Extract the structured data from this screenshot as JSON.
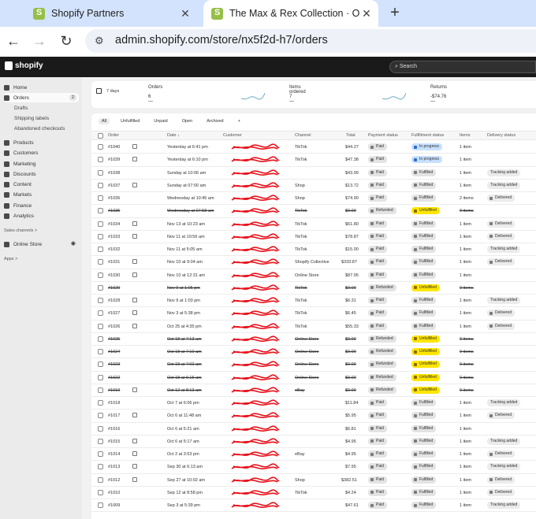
{
  "browser": {
    "tabs": [
      {
        "title": "Shopify Partners"
      },
      {
        "title": "The Max & Rex Collection · Ord"
      }
    ],
    "url": "admin.shopify.com/store/nx5f2d-h7/orders"
  },
  "topbar": {
    "logo": "shopify",
    "search_placeholder": "Search"
  },
  "sidebar": {
    "items": [
      {
        "label": "Home"
      },
      {
        "label": "Orders",
        "badge": "2"
      },
      {
        "label": "Drafts"
      },
      {
        "label": "Shipping labels"
      },
      {
        "label": "Abandoned checkouts"
      },
      {
        "label": "Products"
      },
      {
        "label": "Customers"
      },
      {
        "label": "Marketing"
      },
      {
        "label": "Discounts"
      },
      {
        "label": "Content"
      },
      {
        "label": "Markets"
      },
      {
        "label": "Finance"
      },
      {
        "label": "Analytics"
      }
    ],
    "sales_channels": "Sales channels >",
    "online_store": "Online Store",
    "apps": "Apps >"
  },
  "stats": {
    "range": "7 days",
    "orders_label": "Orders",
    "orders_value": "6 —",
    "items_label": "Items ordered",
    "items_value": "7 —",
    "returns_label": "Returns",
    "returns_value": "-$74.76 —"
  },
  "views": [
    "All",
    "Unfulfilled",
    "Unpaid",
    "Open",
    "Archived",
    "+"
  ],
  "columns": [
    "Order",
    "Date ↓",
    "Customer",
    "Channel",
    "Total",
    "Payment status",
    "Fulfillment status",
    "Items",
    "Delivery status"
  ],
  "orders": [
    {
      "id": "#1040",
      "date": "Yesterday at 6:41 pm",
      "channel": "TikTok",
      "total": "$44.27",
      "payment": "Paid",
      "fulfillment": "In progress",
      "items": "1 item",
      "delivery": "",
      "note": true
    },
    {
      "id": "#1039",
      "date": "Yesterday at 6:10 pm",
      "channel": "TikTok",
      "total": "$47.38",
      "payment": "Paid",
      "fulfillment": "In progress",
      "items": "1 item",
      "delivery": "",
      "note": true
    },
    {
      "id": "#1038",
      "date": "Sunday at 10:06 am",
      "channel": "",
      "total": "$43.99",
      "payment": "Paid",
      "fulfillment": "Fulfilled",
      "items": "1 item",
      "delivery": "Tracking added",
      "note": false
    },
    {
      "id": "#1037",
      "date": "Sunday at 07:00 am",
      "channel": "Shop",
      "total": "$13.72",
      "payment": "Paid",
      "fulfillment": "Fulfilled",
      "items": "1 item",
      "delivery": "Tracking added",
      "note": true
    },
    {
      "id": "#1036",
      "date": "Wednesday at 10:45 am",
      "channel": "Shop",
      "total": "$74.90",
      "payment": "Paid",
      "fulfillment": "Fulfilled",
      "items": "2 items",
      "delivery": "Delivered",
      "note": false
    },
    {
      "id": "#1035",
      "date": "Wednesday at 07:58 am",
      "channel": "TikTok",
      "total": "$0.00",
      "payment": "Refunded",
      "fulfillment": "Unfulfilled",
      "items": "0 items",
      "delivery": "",
      "note": false,
      "void": true
    },
    {
      "id": "#1034",
      "date": "Nov 13 at 10:23 am",
      "channel": "TikTok",
      "total": "$61.80",
      "payment": "Paid",
      "fulfillment": "Fulfilled",
      "items": "1 item",
      "delivery": "Delivered",
      "note": true
    },
    {
      "id": "#1033",
      "date": "Nov 11 at 10:56 am",
      "channel": "TikTok",
      "total": "$78.87",
      "payment": "Paid",
      "fulfillment": "Fulfilled",
      "items": "1 item",
      "delivery": "Delivered",
      "note": true
    },
    {
      "id": "#1032",
      "date": "Nov 11 at 5:05 am",
      "channel": "TikTok",
      "total": "$15.00",
      "payment": "Paid",
      "fulfillment": "Fulfilled",
      "items": "1 item",
      "delivery": "Tracking added",
      "note": false
    },
    {
      "id": "#1031",
      "date": "Nov 10 at 9:04 am",
      "channel": "Shopify Collective",
      "total": "$333.87",
      "payment": "Paid",
      "fulfillment": "Fulfilled",
      "items": "1 item",
      "delivery": "Delivered",
      "note": true
    },
    {
      "id": "#1030",
      "date": "Nov 10 at 12:31 am",
      "channel": "Online Store",
      "total": "$87.95",
      "payment": "Paid",
      "fulfillment": "Fulfilled",
      "items": "1 item",
      "delivery": "",
      "note": true
    },
    {
      "id": "#1029",
      "date": "Nov 9 at 1:05 pm",
      "channel": "TikTok",
      "total": "$0.00",
      "payment": "Refunded",
      "fulfillment": "Unfulfilled",
      "items": "0 items",
      "delivery": "",
      "note": false,
      "void": true
    },
    {
      "id": "#1028",
      "date": "Nov 9 at 1:03 pm",
      "channel": "TikTok",
      "total": "$6.31",
      "payment": "Paid",
      "fulfillment": "Fulfilled",
      "items": "1 item",
      "delivery": "Tracking added",
      "note": true
    },
    {
      "id": "#1027",
      "date": "Nov 3 at 5:38 pm",
      "channel": "TikTok",
      "total": "$6.45",
      "payment": "Paid",
      "fulfillment": "Fulfilled",
      "items": "1 item",
      "delivery": "Delivered",
      "note": true
    },
    {
      "id": "#1026",
      "date": "Oct 25 at 4:35 pm",
      "channel": "TikTok",
      "total": "$55.33",
      "payment": "Paid",
      "fulfillment": "Fulfilled",
      "items": "1 item",
      "delivery": "Delivered",
      "note": true
    },
    {
      "id": "#1025",
      "date": "Oct 18 at 7:13 am",
      "channel": "Online Store",
      "total": "$0.00",
      "payment": "Refunded",
      "fulfillment": "Unfulfilled",
      "items": "0 items",
      "delivery": "",
      "note": false,
      "void": true
    },
    {
      "id": "#1024",
      "date": "Oct 18 at 7:10 am",
      "channel": "Online Store",
      "total": "$0.00",
      "payment": "Refunded",
      "fulfillment": "Unfulfilled",
      "items": "0 items",
      "delivery": "",
      "note": false,
      "void": true
    },
    {
      "id": "#1023",
      "date": "Oct 18 at 7:02 am",
      "channel": "Online Store",
      "total": "$0.00",
      "payment": "Refunded",
      "fulfillment": "Unfulfilled",
      "items": "0 items",
      "delivery": "",
      "note": false,
      "void": true
    },
    {
      "id": "#1022",
      "date": "Oct 18 at 6:15 am",
      "channel": "Online Store",
      "total": "$0.00",
      "payment": "Refunded",
      "fulfillment": "Unfulfilled",
      "items": "0 items",
      "delivery": "",
      "note": false,
      "void": true
    },
    {
      "id": "#1019",
      "date": "Oct 12 at 8:13 am",
      "channel": "eBay",
      "total": "$0.00",
      "payment": "Refunded",
      "fulfillment": "Unfulfilled",
      "items": "0 items",
      "delivery": "",
      "note": true,
      "void": true
    },
    {
      "id": "#1018",
      "date": "Oct 7 at 6:06 pm",
      "channel": "",
      "total": "$11.84",
      "payment": "Paid",
      "fulfillment": "Fulfilled",
      "items": "1 item",
      "delivery": "Tracking added",
      "note": false
    },
    {
      "id": "#1017",
      "date": "Oct 6 at 11:48 am",
      "channel": "",
      "total": "$5.95",
      "payment": "Paid",
      "fulfillment": "Fulfilled",
      "items": "1 item",
      "delivery": "Delivered",
      "note": true
    },
    {
      "id": "#1016",
      "date": "Oct 6 at 5:21 am",
      "channel": "",
      "total": "$6.81",
      "payment": "Paid",
      "fulfillment": "Fulfilled",
      "items": "1 item",
      "delivery": "",
      "note": false
    },
    {
      "id": "#1015",
      "date": "Oct 6 at 5:17 am",
      "channel": "",
      "total": "$4.95",
      "payment": "Paid",
      "fulfillment": "Fulfilled",
      "items": "1 item",
      "delivery": "Tracking added",
      "note": true
    },
    {
      "id": "#1014",
      "date": "Oct 2 at 3:53 pm",
      "channel": "eBay",
      "total": "$4.95",
      "payment": "Paid",
      "fulfillment": "Fulfilled",
      "items": "1 item",
      "delivery": "Delivered",
      "note": true
    },
    {
      "id": "#1013",
      "date": "Sep 30 at 6:13 am",
      "channel": "",
      "total": "$7.95",
      "payment": "Paid",
      "fulfillment": "Fulfilled",
      "items": "1 item",
      "delivery": "Tracking added",
      "note": true
    },
    {
      "id": "#1012",
      "date": "Sep 27 at 10:02 am",
      "channel": "Shop",
      "total": "$382.51",
      "payment": "Paid",
      "fulfillment": "Fulfilled",
      "items": "1 item",
      "delivery": "Delivered",
      "note": true
    },
    {
      "id": "#1010",
      "date": "Sep 12 at 8:58 pm",
      "channel": "TikTok",
      "total": "$4.24",
      "payment": "Paid",
      "fulfillment": "Fulfilled",
      "items": "1 item",
      "delivery": "Delivered",
      "note": false
    },
    {
      "id": "#1009",
      "date": "Sep 3 at 5:39 pm",
      "channel": "",
      "total": "$47.61",
      "payment": "Paid",
      "fulfillment": "Fulfilled",
      "items": "1 item",
      "delivery": "Tracking added",
      "note": false
    }
  ],
  "colors": {
    "topbar": "#1a1a1a",
    "sidebar": "#ebebeb",
    "unfulfilled": "#ffe600",
    "in_progress": "#c8e0ff",
    "redaction": "#e8101a"
  }
}
